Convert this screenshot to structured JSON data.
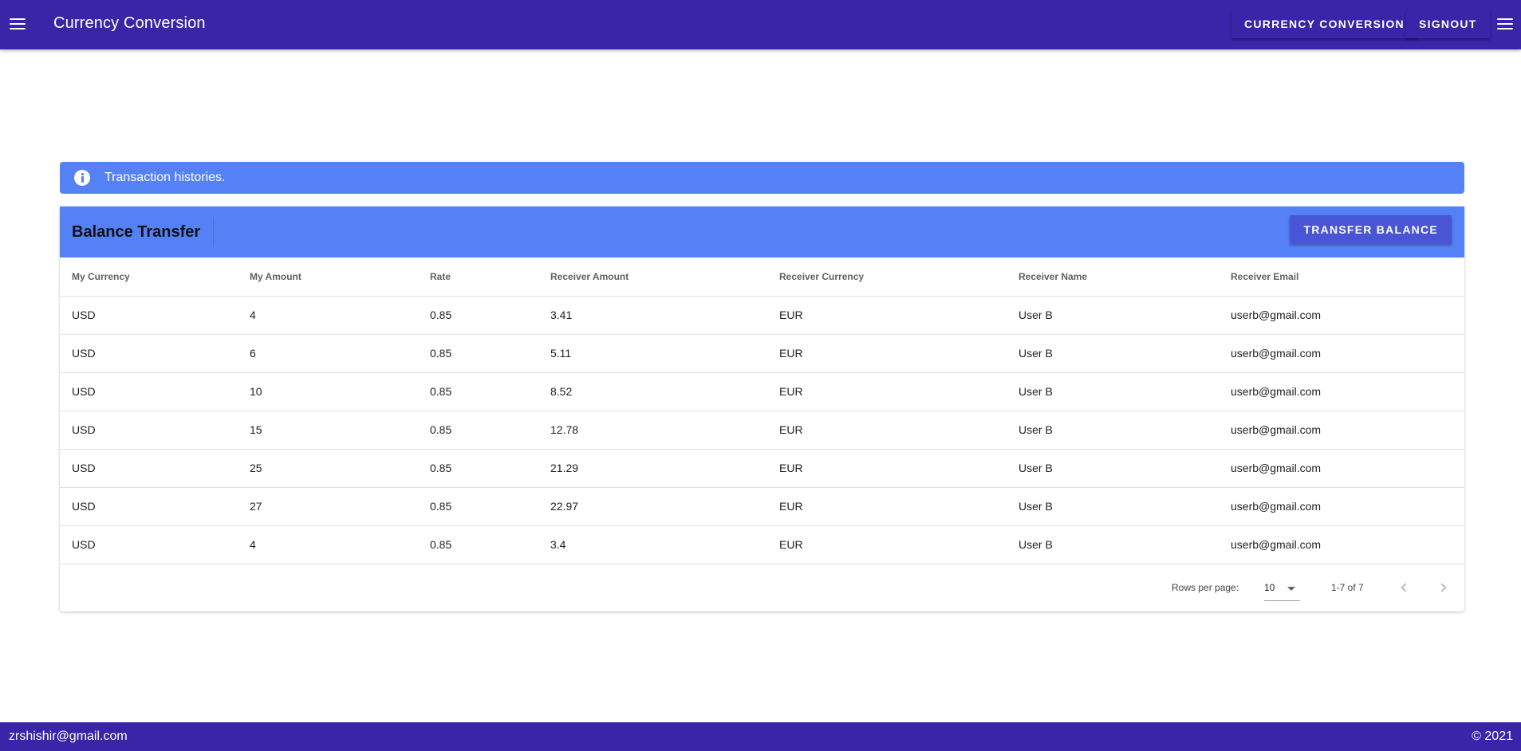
{
  "app_bar": {
    "title": "Currency Conversion",
    "currency_conversion_label": "CURRENCY CONVERSION",
    "signout_label": "SIGNOUT",
    "color": "#3a24a8"
  },
  "alert": {
    "text": "Transaction histories.",
    "icon": "info-icon",
    "color": "#5581f6"
  },
  "card": {
    "title": "Balance Transfer",
    "transfer_label": "TRANSFER BALANCE",
    "columns": [
      "My Currency",
      "My Amount",
      "Rate",
      "Receiver Amount",
      "Receiver Currency",
      "Receiver Name",
      "Receiver Email"
    ],
    "rows": [
      [
        "USD",
        "4",
        "0.85",
        "3.41",
        "EUR",
        "User B",
        "userb@gmail.com"
      ],
      [
        "USD",
        "6",
        "0.85",
        "5.11",
        "EUR",
        "User B",
        "userb@gmail.com"
      ],
      [
        "USD",
        "10",
        "0.85",
        "8.52",
        "EUR",
        "User B",
        "userb@gmail.com"
      ],
      [
        "USD",
        "15",
        "0.85",
        "12.78",
        "EUR",
        "User B",
        "userb@gmail.com"
      ],
      [
        "USD",
        "25",
        "0.85",
        "21.29",
        "EUR",
        "User B",
        "userb@gmail.com"
      ],
      [
        "USD",
        "27",
        "0.85",
        "22.97",
        "EUR",
        "User B",
        "userb@gmail.com"
      ],
      [
        "USD",
        "4",
        "0.85",
        "3.4",
        "EUR",
        "User B",
        "userb@gmail.com"
      ]
    ]
  },
  "pagination": {
    "rows_per_page_label": "Rows per page:",
    "rows_per_page_value": "10",
    "page_info": "1-7 of 7"
  },
  "footer": {
    "email": "zrshishir@gmail.com",
    "copyright": "© 2021"
  }
}
